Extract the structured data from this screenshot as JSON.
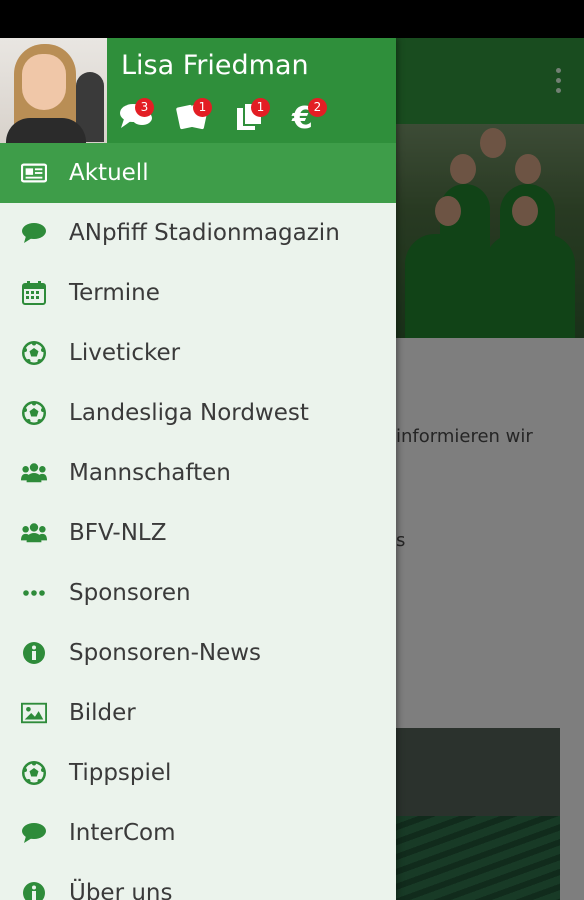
{
  "app": {
    "body_text": "informieren wir",
    "body_text_2": "s"
  },
  "user": {
    "name": "Lisa Friedman"
  },
  "header_icons": [
    {
      "icon": "chat-icon",
      "badge": "3"
    },
    {
      "icon": "tickets-icon",
      "badge": "1"
    },
    {
      "icon": "documents-icon",
      "badge": "1"
    },
    {
      "icon": "euro-icon",
      "badge": "2"
    }
  ],
  "menu": [
    {
      "label": "Aktuell",
      "icon": "newspaper-icon",
      "active": true
    },
    {
      "label": "ANpfiff Stadionmagazin",
      "icon": "speech-bubble-icon"
    },
    {
      "label": "Termine",
      "icon": "calendar-icon"
    },
    {
      "label": "Liveticker",
      "icon": "soccer-ball-icon"
    },
    {
      "label": "Landesliga Nordwest",
      "icon": "soccer-ball-icon"
    },
    {
      "label": "Mannschaften",
      "icon": "group-icon"
    },
    {
      "label": "BFV-NLZ",
      "icon": "group-icon"
    },
    {
      "label": "Sponsoren",
      "icon": "ellipsis-icon"
    },
    {
      "label": "Sponsoren-News",
      "icon": "info-icon"
    },
    {
      "label": "Bilder",
      "icon": "image-icon"
    },
    {
      "label": "Tippspiel",
      "icon": "soccer-ball-icon"
    },
    {
      "label": "InterCom",
      "icon": "speech-bubble-icon"
    },
    {
      "label": "Über uns",
      "icon": "info-icon"
    }
  ],
  "colors": {
    "accent": "#2f8f3b",
    "active_item": "#3e9d49",
    "icon": "#2e8b3a",
    "badge": "#e31e24"
  }
}
